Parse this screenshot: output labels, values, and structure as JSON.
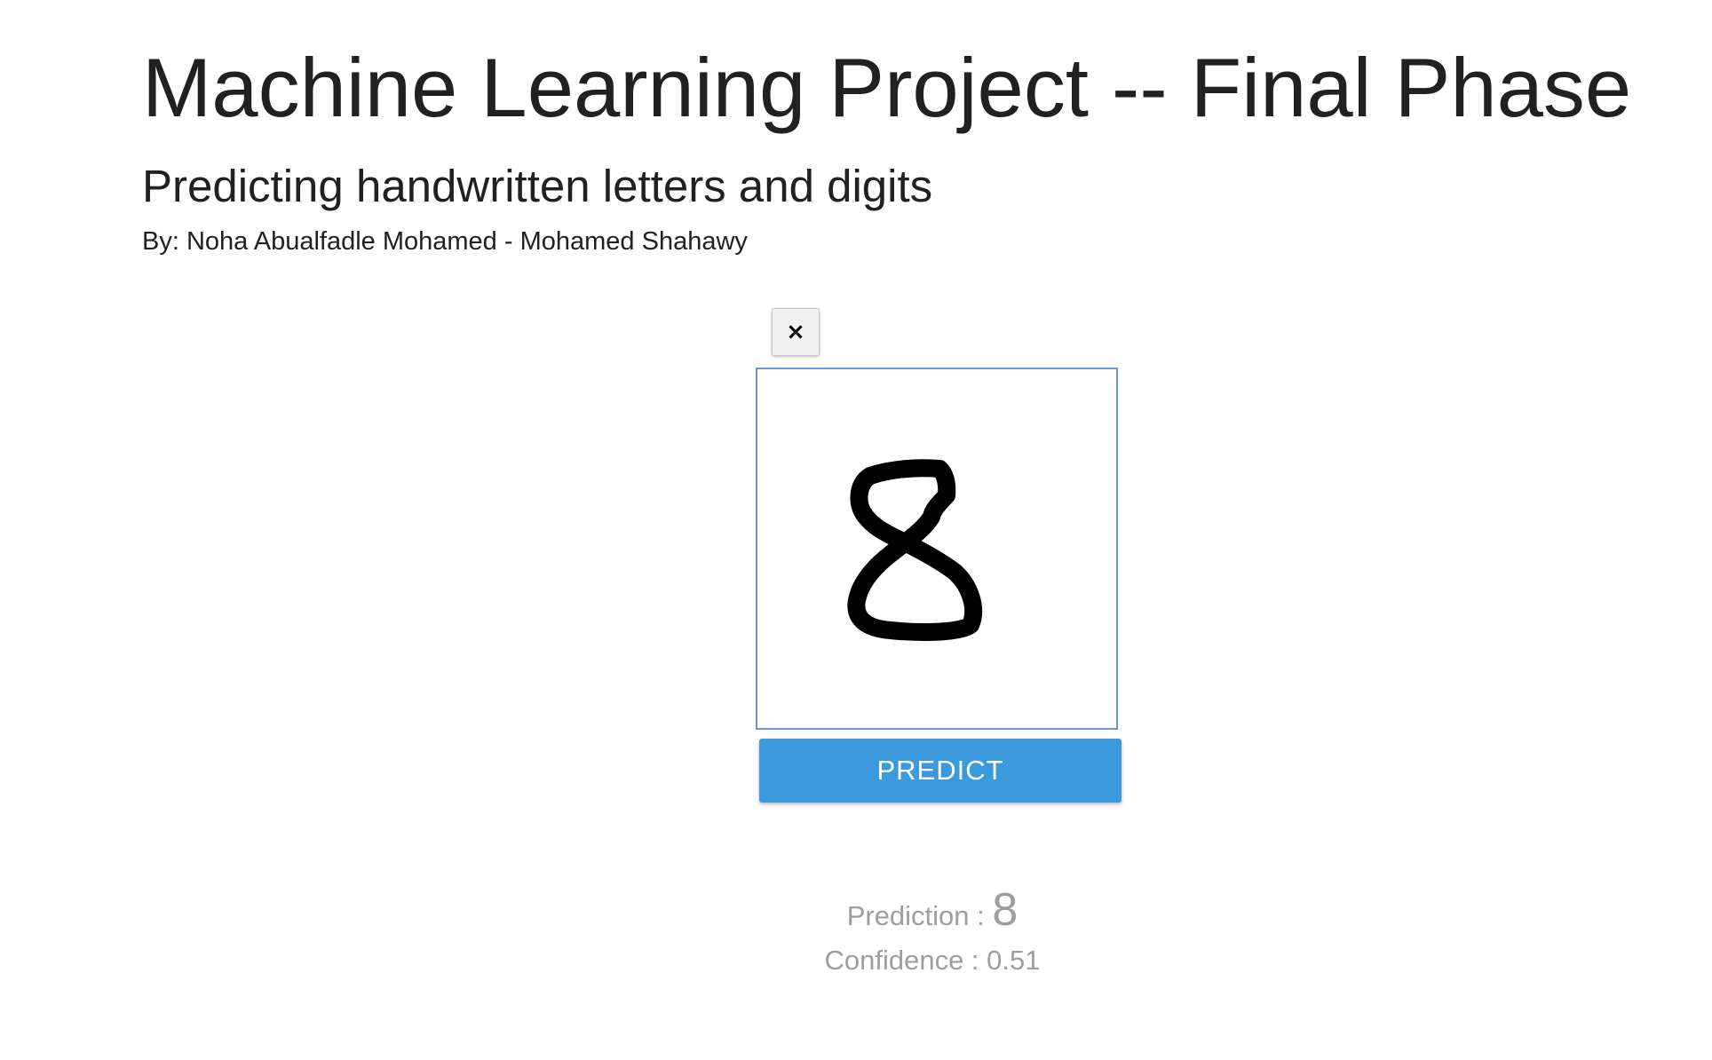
{
  "header": {
    "title": "Machine Learning Project -- Final Phase",
    "subtitle": "Predicting handwritten letters and digits",
    "authors": "By: Noha Abualfadle Mohamed - Mohamed Shahawy"
  },
  "canvas": {
    "clear_label": "×",
    "drawn_glyph": "8"
  },
  "actions": {
    "predict_label": "PREDICT"
  },
  "result": {
    "prediction_label": "Prediction :",
    "prediction_value": "8",
    "confidence_label": "Confidence :",
    "confidence_value": "0.51"
  },
  "colors": {
    "primary_button": "#3b9adb",
    "canvas_border": "#6b96d8",
    "result_text": "#9e9e9e"
  }
}
